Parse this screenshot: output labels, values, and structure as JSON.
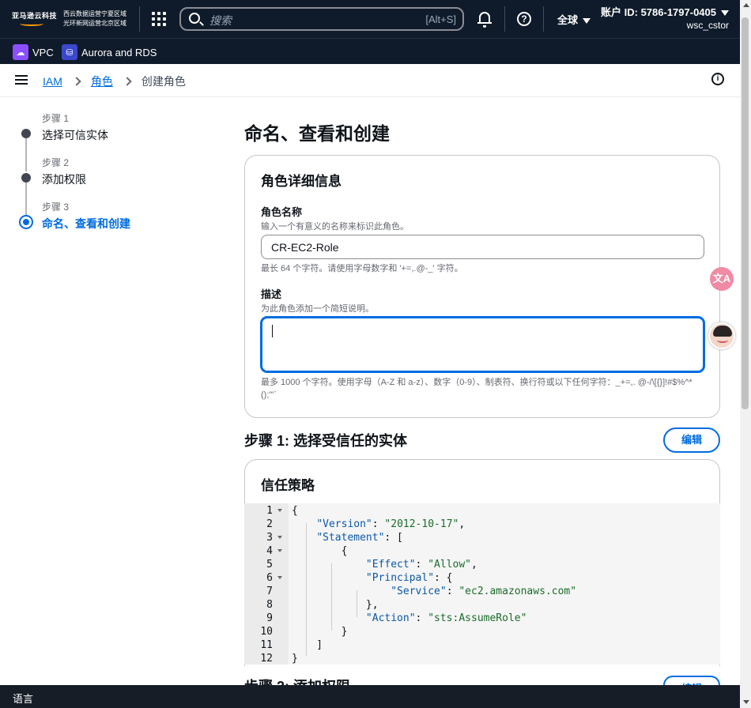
{
  "topbar": {
    "logo_text": "亚马逊云科技",
    "region_line1": "西云数据运营宁夏区域",
    "region_line2": "光环新网运营北京区域",
    "search_placeholder": "搜索",
    "search_shortcut": "[Alt+S]",
    "region_select": "全球",
    "account": "账户 ID: 5786-1797-0405",
    "username": "wsc_cstor"
  },
  "favorites": [
    {
      "label": "VPC",
      "icon": "vpc-icon"
    },
    {
      "label": "Aurora and RDS",
      "icon": "rds-icon"
    }
  ],
  "breadcrumb": {
    "items": [
      "IAM",
      "角色"
    ],
    "current": "创建角色"
  },
  "steps": [
    {
      "num": "步骤 1",
      "label": "选择可信实体",
      "state": "done"
    },
    {
      "num": "步骤 2",
      "label": "添加权限",
      "state": "done"
    },
    {
      "num": "步骤 3",
      "label": "命名、查看和创建",
      "state": "active"
    }
  ],
  "page_title": "命名、查看和创建",
  "role_details": {
    "heading": "角色详细信息",
    "name_label": "角色名称",
    "name_desc": "输入一个有意义的名称来标识此角色。",
    "name_value": "CR-EC2-Role",
    "name_hint": "最长 64 个字符。请使用字母数字和 '+=,.@-_' 字符。",
    "desc_label": "描述",
    "desc_desc": "为此角色添加一个简短说明。",
    "desc_value": "",
    "desc_hint": "最多 1000 个字符。使用字母（A-Z 和 a-z）、数字（0-9）、制表符、换行符或以下任何字符：_+=,. @-/\\[{}]!#$%^*();\"'`"
  },
  "step1_section": {
    "heading": "步骤 1: 选择受信任的实体",
    "edit": "编辑",
    "policy_heading": "信任策略",
    "code_lines": [
      "{",
      "    \"Version\": \"2012-10-17\",",
      "    \"Statement\": [",
      "        {",
      "            \"Effect\": \"Allow\",",
      "            \"Principal\": {",
      "                \"Service\": \"ec2.amazonaws.com\"",
      "            },",
      "            \"Action\": \"sts:AssumeRole\"",
      "        }",
      "    ]",
      "}"
    ],
    "line_numbers": [
      "1",
      "2",
      "3",
      "4",
      "5",
      "6",
      "7",
      "8",
      "9",
      "10",
      "11",
      "12"
    ]
  },
  "step2_section": {
    "heading": "步骤 2: 添加权限",
    "edit": "编辑"
  },
  "footer": {
    "language": "语言"
  },
  "colors": {
    "accent": "#006ce0",
    "topbar": "#0f1b2a",
    "brand_orange": "#ff9900"
  }
}
